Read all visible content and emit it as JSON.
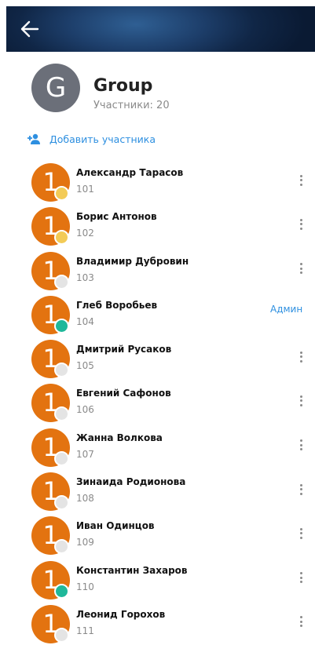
{
  "header": {
    "back_icon": "arrow-left-icon",
    "group_initial": "G",
    "group_name": "Group",
    "member_count": "Участники: 20"
  },
  "actions": {
    "add_member_icon": "add-person-icon",
    "add_member_label": "Добавить участника"
  },
  "colors": {
    "accent": "#2d8fe0",
    "avatar": "#e37310",
    "status_away": "#f3cb57",
    "status_online": "#1fb89a",
    "status_offline": "#e4e4e4"
  },
  "members": [
    {
      "initial": "1",
      "name": "Александр Тарасов",
      "ext": "101",
      "status": "away",
      "menu_icon": "more-vert-icon"
    },
    {
      "initial": "1",
      "name": "Борис Антонов",
      "ext": "102",
      "status": "away",
      "menu_icon": "more-vert-icon"
    },
    {
      "initial": "1",
      "name": "Владимир Дубровин",
      "ext": "103",
      "status": "offline",
      "menu_icon": "more-vert-icon"
    },
    {
      "initial": "1",
      "name": "Глеб Воробьев",
      "ext": "104",
      "status": "online",
      "role": "Админ"
    },
    {
      "initial": "1",
      "name": "Дмитрий Русаков",
      "ext": "105",
      "status": "offline",
      "menu_icon": "more-vert-icon"
    },
    {
      "initial": "1",
      "name": "Евгений Сафонов",
      "ext": "106",
      "status": "offline",
      "menu_icon": "more-vert-icon"
    },
    {
      "initial": "1",
      "name": "Жанна Волкова",
      "ext": "107",
      "status": "offline",
      "menu_icon": "more-vert-icon"
    },
    {
      "initial": "1",
      "name": "Зинаида Родионова",
      "ext": "108",
      "status": "offline",
      "menu_icon": "more-vert-icon"
    },
    {
      "initial": "1",
      "name": "Иван Одинцов",
      "ext": "109",
      "status": "offline",
      "menu_icon": "more-vert-icon"
    },
    {
      "initial": "1",
      "name": "Константин Захаров",
      "ext": "110",
      "status": "online",
      "menu_icon": "more-vert-icon"
    },
    {
      "initial": "1",
      "name": "Леонид Горохов",
      "ext": "111",
      "status": "offline",
      "menu_icon": "more-vert-icon"
    }
  ]
}
